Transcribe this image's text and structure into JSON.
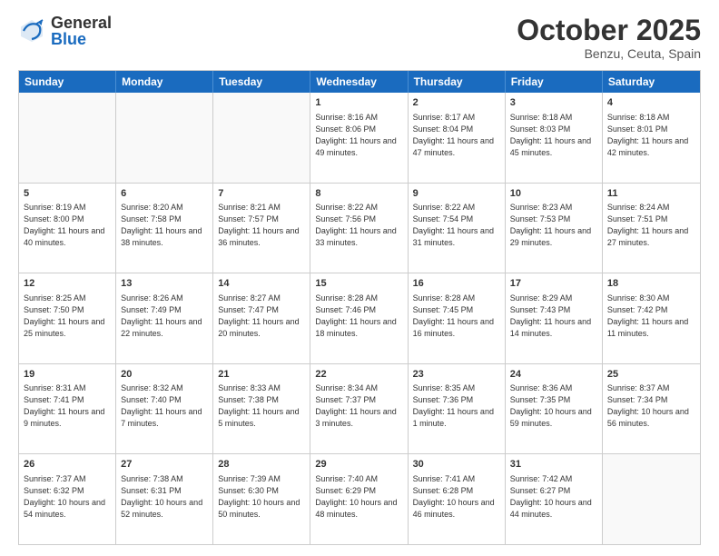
{
  "header": {
    "logo_general": "General",
    "logo_blue": "Blue",
    "month_title": "October 2025",
    "location": "Benzu, Ceuta, Spain"
  },
  "days_of_week": [
    "Sunday",
    "Monday",
    "Tuesday",
    "Wednesday",
    "Thursday",
    "Friday",
    "Saturday"
  ],
  "rows": [
    [
      {
        "day": "",
        "text": ""
      },
      {
        "day": "",
        "text": ""
      },
      {
        "day": "",
        "text": ""
      },
      {
        "day": "1",
        "text": "Sunrise: 8:16 AM\nSunset: 8:06 PM\nDaylight: 11 hours and 49 minutes."
      },
      {
        "day": "2",
        "text": "Sunrise: 8:17 AM\nSunset: 8:04 PM\nDaylight: 11 hours and 47 minutes."
      },
      {
        "day": "3",
        "text": "Sunrise: 8:18 AM\nSunset: 8:03 PM\nDaylight: 11 hours and 45 minutes."
      },
      {
        "day": "4",
        "text": "Sunrise: 8:18 AM\nSunset: 8:01 PM\nDaylight: 11 hours and 42 minutes."
      }
    ],
    [
      {
        "day": "5",
        "text": "Sunrise: 8:19 AM\nSunset: 8:00 PM\nDaylight: 11 hours and 40 minutes."
      },
      {
        "day": "6",
        "text": "Sunrise: 8:20 AM\nSunset: 7:58 PM\nDaylight: 11 hours and 38 minutes."
      },
      {
        "day": "7",
        "text": "Sunrise: 8:21 AM\nSunset: 7:57 PM\nDaylight: 11 hours and 36 minutes."
      },
      {
        "day": "8",
        "text": "Sunrise: 8:22 AM\nSunset: 7:56 PM\nDaylight: 11 hours and 33 minutes."
      },
      {
        "day": "9",
        "text": "Sunrise: 8:22 AM\nSunset: 7:54 PM\nDaylight: 11 hours and 31 minutes."
      },
      {
        "day": "10",
        "text": "Sunrise: 8:23 AM\nSunset: 7:53 PM\nDaylight: 11 hours and 29 minutes."
      },
      {
        "day": "11",
        "text": "Sunrise: 8:24 AM\nSunset: 7:51 PM\nDaylight: 11 hours and 27 minutes."
      }
    ],
    [
      {
        "day": "12",
        "text": "Sunrise: 8:25 AM\nSunset: 7:50 PM\nDaylight: 11 hours and 25 minutes."
      },
      {
        "day": "13",
        "text": "Sunrise: 8:26 AM\nSunset: 7:49 PM\nDaylight: 11 hours and 22 minutes."
      },
      {
        "day": "14",
        "text": "Sunrise: 8:27 AM\nSunset: 7:47 PM\nDaylight: 11 hours and 20 minutes."
      },
      {
        "day": "15",
        "text": "Sunrise: 8:28 AM\nSunset: 7:46 PM\nDaylight: 11 hours and 18 minutes."
      },
      {
        "day": "16",
        "text": "Sunrise: 8:28 AM\nSunset: 7:45 PM\nDaylight: 11 hours and 16 minutes."
      },
      {
        "day": "17",
        "text": "Sunrise: 8:29 AM\nSunset: 7:43 PM\nDaylight: 11 hours and 14 minutes."
      },
      {
        "day": "18",
        "text": "Sunrise: 8:30 AM\nSunset: 7:42 PM\nDaylight: 11 hours and 11 minutes."
      }
    ],
    [
      {
        "day": "19",
        "text": "Sunrise: 8:31 AM\nSunset: 7:41 PM\nDaylight: 11 hours and 9 minutes."
      },
      {
        "day": "20",
        "text": "Sunrise: 8:32 AM\nSunset: 7:40 PM\nDaylight: 11 hours and 7 minutes."
      },
      {
        "day": "21",
        "text": "Sunrise: 8:33 AM\nSunset: 7:38 PM\nDaylight: 11 hours and 5 minutes."
      },
      {
        "day": "22",
        "text": "Sunrise: 8:34 AM\nSunset: 7:37 PM\nDaylight: 11 hours and 3 minutes."
      },
      {
        "day": "23",
        "text": "Sunrise: 8:35 AM\nSunset: 7:36 PM\nDaylight: 11 hours and 1 minute."
      },
      {
        "day": "24",
        "text": "Sunrise: 8:36 AM\nSunset: 7:35 PM\nDaylight: 10 hours and 59 minutes."
      },
      {
        "day": "25",
        "text": "Sunrise: 8:37 AM\nSunset: 7:34 PM\nDaylight: 10 hours and 56 minutes."
      }
    ],
    [
      {
        "day": "26",
        "text": "Sunrise: 7:37 AM\nSunset: 6:32 PM\nDaylight: 10 hours and 54 minutes."
      },
      {
        "day": "27",
        "text": "Sunrise: 7:38 AM\nSunset: 6:31 PM\nDaylight: 10 hours and 52 minutes."
      },
      {
        "day": "28",
        "text": "Sunrise: 7:39 AM\nSunset: 6:30 PM\nDaylight: 10 hours and 50 minutes."
      },
      {
        "day": "29",
        "text": "Sunrise: 7:40 AM\nSunset: 6:29 PM\nDaylight: 10 hours and 48 minutes."
      },
      {
        "day": "30",
        "text": "Sunrise: 7:41 AM\nSunset: 6:28 PM\nDaylight: 10 hours and 46 minutes."
      },
      {
        "day": "31",
        "text": "Sunrise: 7:42 AM\nSunset: 6:27 PM\nDaylight: 10 hours and 44 minutes."
      },
      {
        "day": "",
        "text": ""
      }
    ]
  ]
}
